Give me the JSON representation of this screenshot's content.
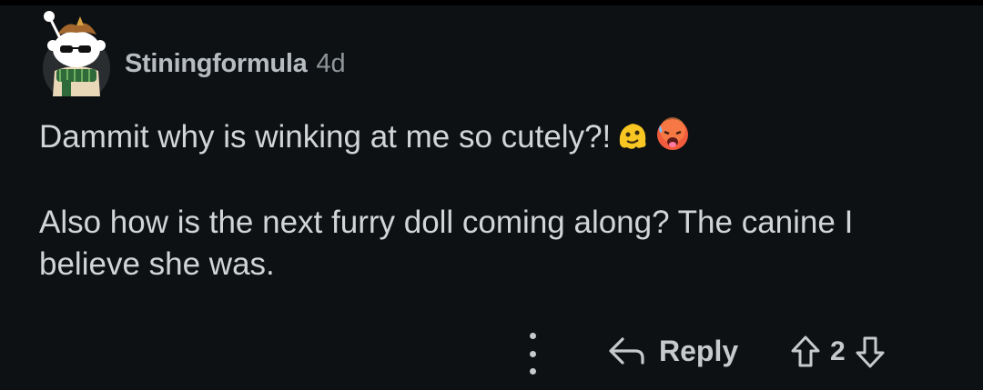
{
  "comment": {
    "author": "Stiningformula",
    "age": "4d",
    "paragraphs": [
      "Dammit why is winking at me so cutely?!",
      "Also how is the next furry doll coming along? The canine I believe she was."
    ],
    "emojis": [
      "melting-face-emoji",
      "hot-face-emoji"
    ]
  },
  "actions": {
    "more_icon": "more-vertical-icon",
    "reply_label": "Reply",
    "reply_icon": "reply-arrow-icon",
    "upvote_icon": "upvote-arrow-icon",
    "score": "2",
    "downvote_icon": "downvote-arrow-icon"
  },
  "colors": {
    "background": "#0e1113",
    "text": "#d2d5d7",
    "muted": "#8e9599"
  }
}
